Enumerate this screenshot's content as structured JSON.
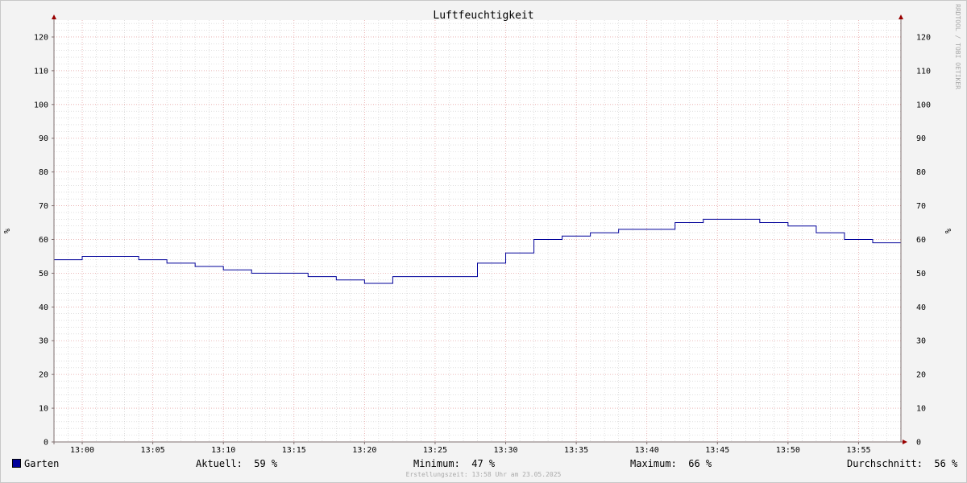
{
  "chart_data": {
    "type": "line",
    "title": "Luftfeuchtigkeit",
    "ylabel": "%",
    "ylim": [
      0,
      125
    ],
    "yticks": [
      0,
      10,
      20,
      30,
      40,
      50,
      60,
      70,
      80,
      90,
      100,
      110,
      120
    ],
    "xlim": [
      "12:58",
      "13:58"
    ],
    "xticks": [
      "13:00",
      "13:05",
      "13:10",
      "13:15",
      "13:20",
      "13:25",
      "13:30",
      "13:35",
      "13:40",
      "13:45",
      "13:50",
      "13:55"
    ],
    "grid": true,
    "step": true,
    "series": [
      {
        "name": "Garten",
        "color": "#000099",
        "points": [
          [
            "12:58",
            54
          ],
          [
            "13:00",
            55
          ],
          [
            "13:04",
            54
          ],
          [
            "13:06",
            53
          ],
          [
            "13:08",
            52
          ],
          [
            "13:10",
            51
          ],
          [
            "13:12",
            50
          ],
          [
            "13:16",
            49
          ],
          [
            "13:18",
            48
          ],
          [
            "13:20",
            47
          ],
          [
            "13:22",
            49
          ],
          [
            "13:28",
            53
          ],
          [
            "13:30",
            56
          ],
          [
            "13:32",
            60
          ],
          [
            "13:34",
            61
          ],
          [
            "13:36",
            62
          ],
          [
            "13:38",
            63
          ],
          [
            "13:42",
            65
          ],
          [
            "13:44",
            66
          ],
          [
            "13:48",
            65
          ],
          [
            "13:50",
            64
          ],
          [
            "13:52",
            62
          ],
          [
            "13:54",
            60
          ],
          [
            "13:56",
            59
          ],
          [
            "13:58",
            59
          ]
        ]
      }
    ]
  },
  "legend": {
    "series_name": "Garten",
    "current_label": "Aktuell:",
    "current_value": "59 %",
    "min_label": "Minimum:",
    "min_value": "47 %",
    "max_label": "Maximum:",
    "max_value": "66 %",
    "avg_label": "Durchschnitt:",
    "avg_value": "56 %"
  },
  "watermark": "RRDTOOL / TOBI OETIKER",
  "footer": "Erstellungszeit: 13:58 Uhr am 23.05.2025",
  "colors": {
    "background": "#f3f3f3",
    "canvas": "#ffffff",
    "major_grid": "#e6a6a6",
    "minor_grid": "#cccccc",
    "axis": "#7f6f6f",
    "arrow": "#990000"
  }
}
